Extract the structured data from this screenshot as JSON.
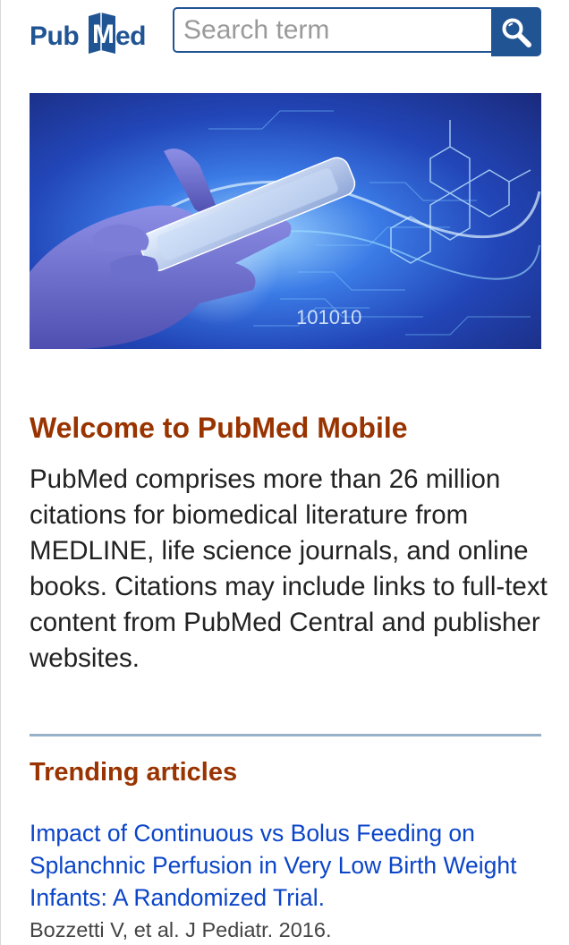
{
  "header": {
    "logo_pub": "Pub",
    "logo_m": "M",
    "logo_ed": "ed",
    "search_placeholder": "Search term",
    "search_value": ""
  },
  "hero": {
    "binary_text": "101010"
  },
  "welcome": {
    "title": "Welcome to PubMed Mobile",
    "body": "PubMed comprises more than 26 million citations for biomedical literature from MEDLINE, life science journals, and online books. Citations may include links to full-text content from PubMed Central and publisher websites."
  },
  "trending": {
    "title": "Trending articles",
    "articles": [
      {
        "title": "Impact of Continuous vs Bolus Feeding on Splanchnic Perfusion in Very Low Birth Weight Infants: A Randomized Trial.",
        "meta": "Bozzetti V, et al. J Pediatr. 2016."
      }
    ]
  },
  "colors": {
    "brand_blue": "#205493",
    "heading_brown": "#993300",
    "link_blue": "#0b45c8"
  }
}
